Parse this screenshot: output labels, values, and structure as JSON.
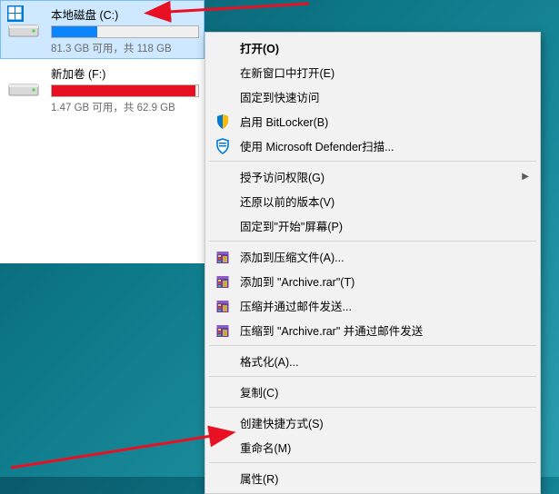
{
  "drives": [
    {
      "name": "本地磁盘 (C:)",
      "stats": "81.3 GB 可用，共 118 GB",
      "fill": 31,
      "color": "blue",
      "selected": true
    },
    {
      "name": "新加卷 (F:)",
      "stats": "1.47 GB 可用，共 62.9 GB",
      "fill": 98,
      "color": "red",
      "selected": false
    }
  ],
  "menu": {
    "items": [
      {
        "label": "打开(O)",
        "bold": true
      },
      {
        "label": "在新窗口中打开(E)"
      },
      {
        "label": "固定到快速访问"
      },
      {
        "label": "启用 BitLocker(B)",
        "icon": "shield-blue"
      },
      {
        "label": "使用 Microsoft Defender扫描...",
        "icon": "shield-outline"
      },
      {
        "sep": true
      },
      {
        "label": "授予访问权限(G)",
        "submenu": true
      },
      {
        "label": "还原以前的版本(V)"
      },
      {
        "label": "固定到\"开始\"屏幕(P)"
      },
      {
        "sep": true
      },
      {
        "label": "添加到压缩文件(A)...",
        "icon": "rar"
      },
      {
        "label": "添加到 \"Archive.rar\"(T)",
        "icon": "rar"
      },
      {
        "label": "压缩并通过邮件发送...",
        "icon": "rar"
      },
      {
        "label": "压缩到 \"Archive.rar\" 并通过邮件发送",
        "icon": "rar"
      },
      {
        "sep": true
      },
      {
        "label": "格式化(A)..."
      },
      {
        "sep": true
      },
      {
        "label": "复制(C)"
      },
      {
        "sep": true
      },
      {
        "label": "创建快捷方式(S)"
      },
      {
        "label": "重命名(M)"
      },
      {
        "sep": true
      },
      {
        "label": "属性(R)"
      }
    ]
  }
}
